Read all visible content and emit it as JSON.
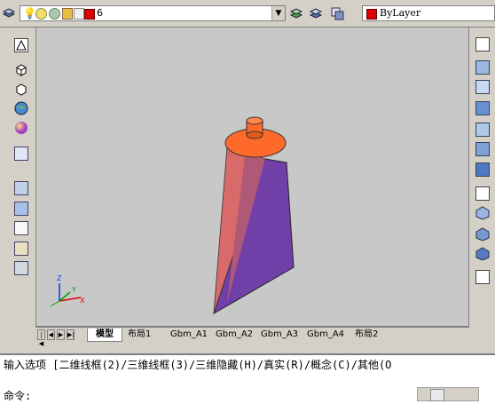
{
  "toolbar": {
    "layer_name": "6",
    "linetype": "ByLayer",
    "layer_color": "#e00000"
  },
  "tabs": {
    "model": "模型",
    "layout1": "布局1",
    "gbm_a1": "Gbm_A1",
    "gbm_a2": "Gbm_A2",
    "gbm_a3": "Gbm_A3",
    "gbm_a4": "Gbm_A4",
    "layout2": "布局2"
  },
  "ucs": {
    "x": "X",
    "y": "Y",
    "z": "Z"
  },
  "command": {
    "options_line": "输入选项 [二维线框(2)/三维线框(3)/三维隐藏(H)/真实(R)/概念(C)/其他(O",
    "prompt": "命令:"
  },
  "colors": {
    "viewport_bg": "#c8c8c8",
    "shape_top": "#ff6a2a",
    "shape_side_light": "#d86a6a",
    "shape_side_dark": "#7040a8"
  }
}
